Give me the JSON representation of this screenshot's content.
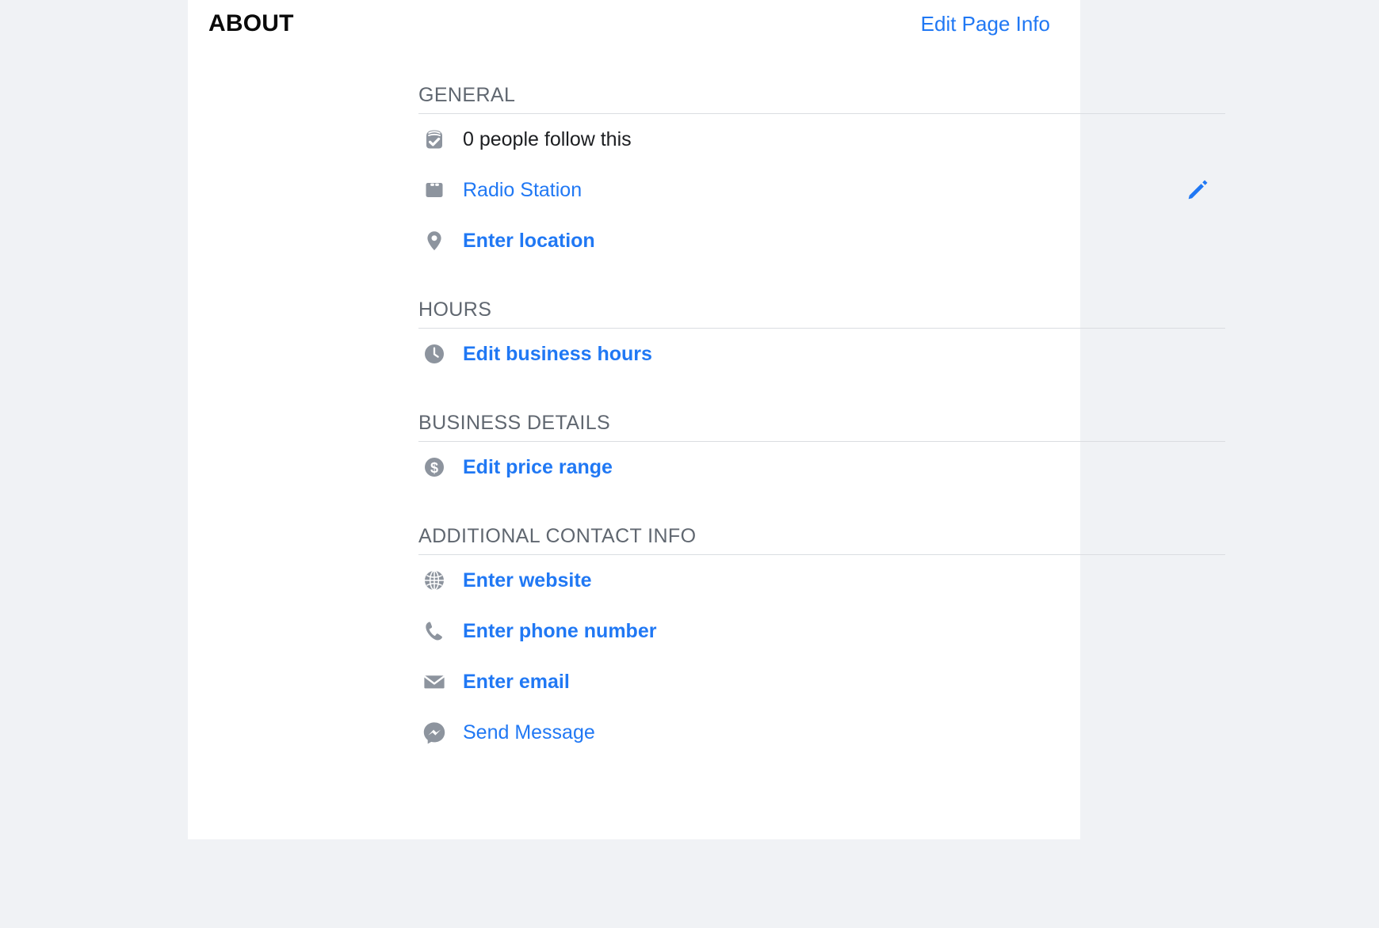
{
  "header": {
    "title": "ABOUT",
    "edit_page_info_label": "Edit Page Info"
  },
  "colors": {
    "page_background": "#f0f2f5",
    "card_background": "#ffffff",
    "link_blue": "#2078f4",
    "icon_gray": "#8d949e",
    "section_title_gray": "#606770",
    "divider_gray": "#dadde1",
    "text_black": "#1c1e21"
  },
  "sections": [
    {
      "id": "general",
      "title": "GENERAL",
      "rows": [
        {
          "icon": "follow-check-icon",
          "label": "0 people follow this",
          "style": "plain",
          "action": null
        },
        {
          "icon": "briefcase-icon",
          "label": "Radio Station",
          "style": "link",
          "action": "pencil-edit-icon"
        },
        {
          "icon": "location-pin-icon",
          "label": "Enter location",
          "style": "link-bold",
          "action": null
        }
      ]
    },
    {
      "id": "hours",
      "title": "HOURS",
      "rows": [
        {
          "icon": "clock-icon",
          "label": "Edit business hours",
          "style": "link-bold",
          "action": null
        }
      ]
    },
    {
      "id": "business-details",
      "title": "BUSINESS DETAILS",
      "rows": [
        {
          "icon": "dollar-circle-icon",
          "label": "Edit price range",
          "style": "link-bold",
          "action": null
        }
      ]
    },
    {
      "id": "additional-contact-info",
      "title": "ADDITIONAL CONTACT INFO",
      "rows": [
        {
          "icon": "globe-icon",
          "label": "Enter website",
          "style": "link-bold",
          "action": null
        },
        {
          "icon": "phone-icon",
          "label": "Enter phone number",
          "style": "link-bold",
          "action": null
        },
        {
          "icon": "envelope-icon",
          "label": "Enter email",
          "style": "link-bold",
          "action": null
        },
        {
          "icon": "messenger-icon",
          "label": "Send Message",
          "style": "link",
          "action": null
        }
      ]
    }
  ]
}
